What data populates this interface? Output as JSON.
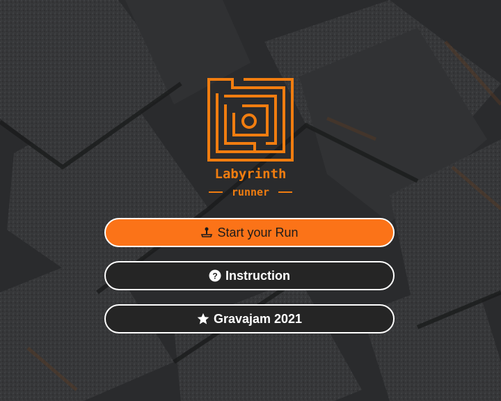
{
  "logo": {
    "line1": "Labyrinth",
    "line2": "runner",
    "color": "#f07d10"
  },
  "menu": {
    "start": {
      "label": "Start your Run",
      "icon": "joystick-icon"
    },
    "instruction": {
      "label": "Instruction",
      "icon": "question-circle-icon"
    },
    "gravajam": {
      "label": "Gravajam 2021",
      "icon": "star-icon"
    }
  },
  "colors": {
    "primary_button": "#fb7318",
    "secondary_button": "#252525",
    "background": "#2b2c2e"
  }
}
